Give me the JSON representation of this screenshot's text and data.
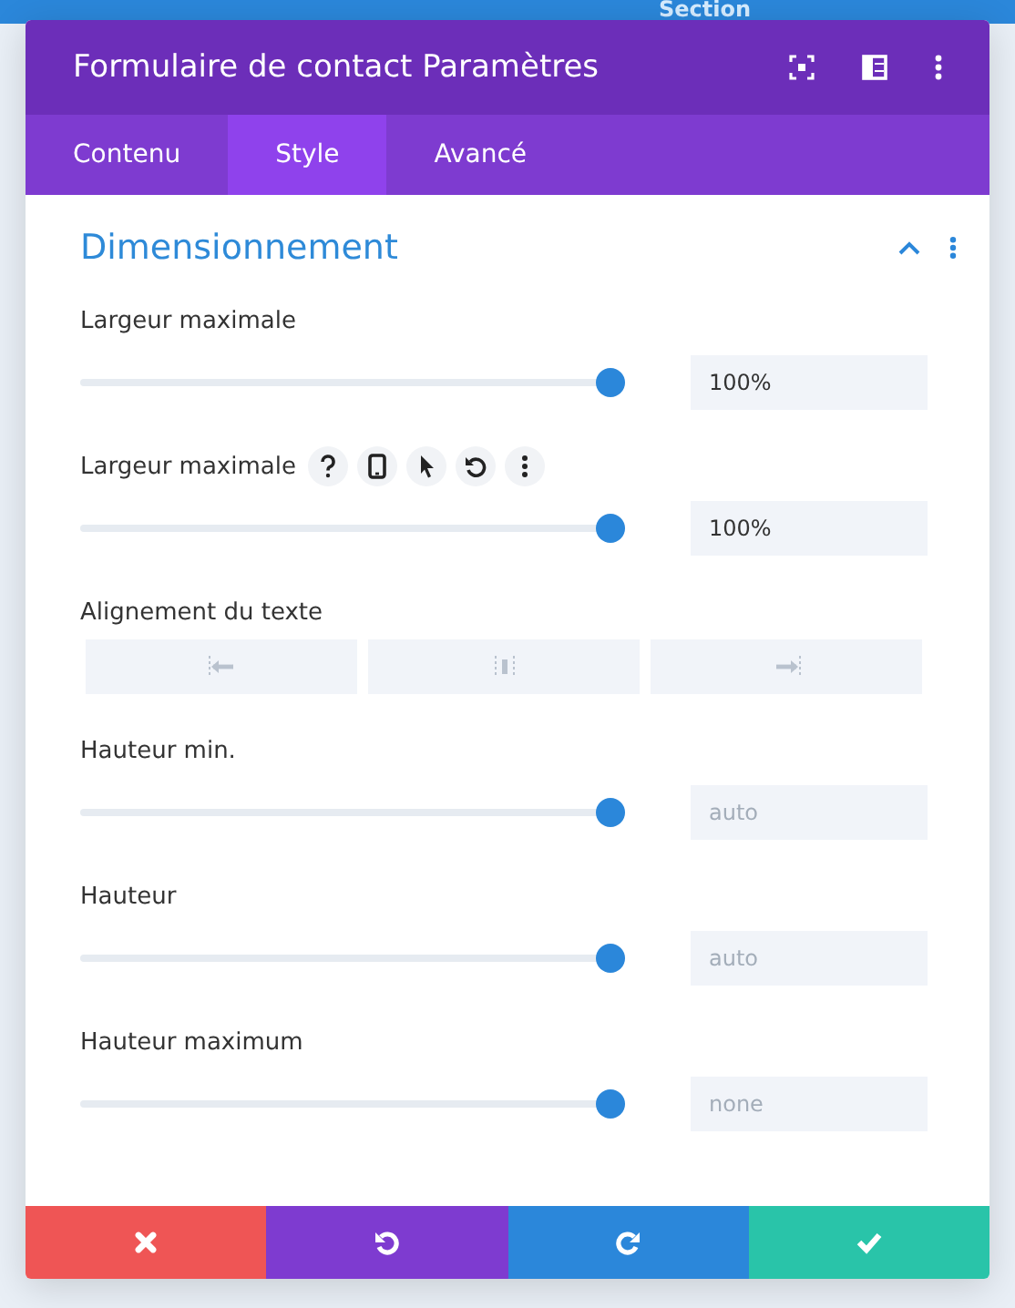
{
  "background": {
    "bar_label": "Section"
  },
  "modal": {
    "title": "Formulaire de contact Paramètres",
    "tabs": [
      {
        "label": "Contenu",
        "selected": false
      },
      {
        "label": "Style",
        "selected": true
      },
      {
        "label": "Avancé",
        "selected": false
      }
    ],
    "section": {
      "title": "Dimensionnement",
      "expanded": true,
      "settings": [
        {
          "kind": "slider",
          "label": "Largeur maximale",
          "hovered": false,
          "level": 1,
          "value": "100%"
        },
        {
          "kind": "slider",
          "label": "Largeur maximale",
          "hovered": true,
          "level": 1,
          "value": "100%"
        },
        {
          "kind": "align",
          "label": "Alignement du texte"
        },
        {
          "kind": "slider",
          "label": "Hauteur min.",
          "hovered": false,
          "level": 1,
          "placeholder": "auto"
        },
        {
          "kind": "slider",
          "label": "Hauteur",
          "hovered": false,
          "level": 1,
          "placeholder": "auto"
        },
        {
          "kind": "slider",
          "label": "Hauteur maximum",
          "hovered": false,
          "level": 1,
          "placeholder": "none"
        }
      ]
    }
  }
}
